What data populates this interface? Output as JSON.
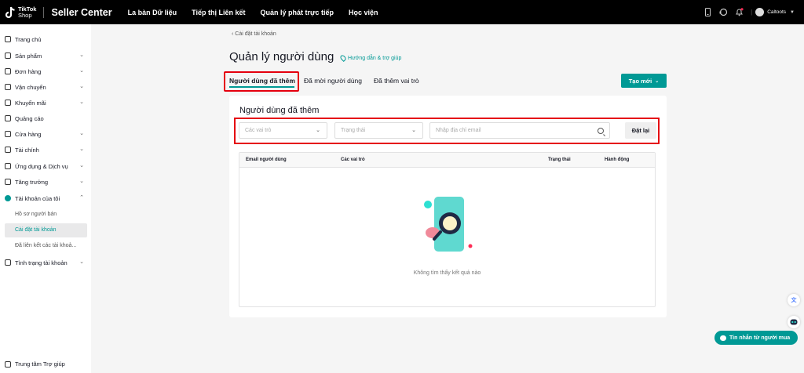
{
  "topbar": {
    "logo_line1": "TikTok",
    "logo_line2": "Shop",
    "brand": "Seller Center",
    "nav": [
      "La bàn Dữ liệu",
      "Tiếp thị Liên kết",
      "Quản lý phát trực tiếp",
      "Học viện"
    ],
    "account": "Caltoots",
    "icons": [
      "phone-icon",
      "support-icon",
      "notification-bell-icon",
      "avatar"
    ]
  },
  "sidebar": {
    "items": [
      {
        "label": "Trang chủ",
        "icon": "home-icon"
      },
      {
        "label": "Sản phẩm",
        "icon": "product-icon"
      },
      {
        "label": "Đơn hàng",
        "icon": "order-icon"
      },
      {
        "label": "Vận chuyển",
        "icon": "truck-icon"
      },
      {
        "label": "Khuyến mãi",
        "icon": "megaphone-icon"
      },
      {
        "label": "Quảng cáo",
        "icon": "ads-icon"
      },
      {
        "label": "Cửa hàng",
        "icon": "store-icon"
      },
      {
        "label": "Tài chính",
        "icon": "finance-icon"
      },
      {
        "label": "Ứng dụng & Dịch vụ",
        "icon": "apps-icon"
      },
      {
        "label": "Tăng trưởng",
        "icon": "growth-icon"
      },
      {
        "label": "Tài khoản của tôi",
        "icon": "user-icon"
      },
      {
        "label": "Tình trạng tài khoản",
        "icon": "shield-icon"
      }
    ],
    "sub_items": [
      "Hồ sơ người bán",
      "Cài đặt tài khoản",
      "Đã liên kết các tài khoả..."
    ],
    "footer": "Trung tâm Trợ giúp"
  },
  "main": {
    "breadcrumb": "Cài đặt tài khoản",
    "title": "Quản lý người dùng",
    "help_link": "Hướng dẫn & trợ giúp",
    "tabs": [
      "Người dùng đã thêm",
      "Đã mời người dùng",
      "Đã thêm vai trò"
    ],
    "create_button": "Tạo mới",
    "card_title": "Người dùng đã thêm",
    "filters": {
      "role_placeholder": "Các vai trò",
      "status_placeholder": "Trạng thái",
      "email_placeholder": "Nhập địa chỉ email",
      "reset_button": "Đặt lại"
    },
    "table": {
      "columns": [
        "Email người dùng",
        "Các vai trò",
        "Trạng thái",
        "Hành động"
      ],
      "empty_text": "Không tìm thấy kết quả nào"
    }
  },
  "floating": {
    "chat_label": "Tin nhắn từ người mua",
    "translate_icon": "translate-icon",
    "bot_icon": "bot-icon"
  },
  "colors": {
    "accent": "#009995",
    "highlight": "#e5000e",
    "topbar": "#000000"
  }
}
